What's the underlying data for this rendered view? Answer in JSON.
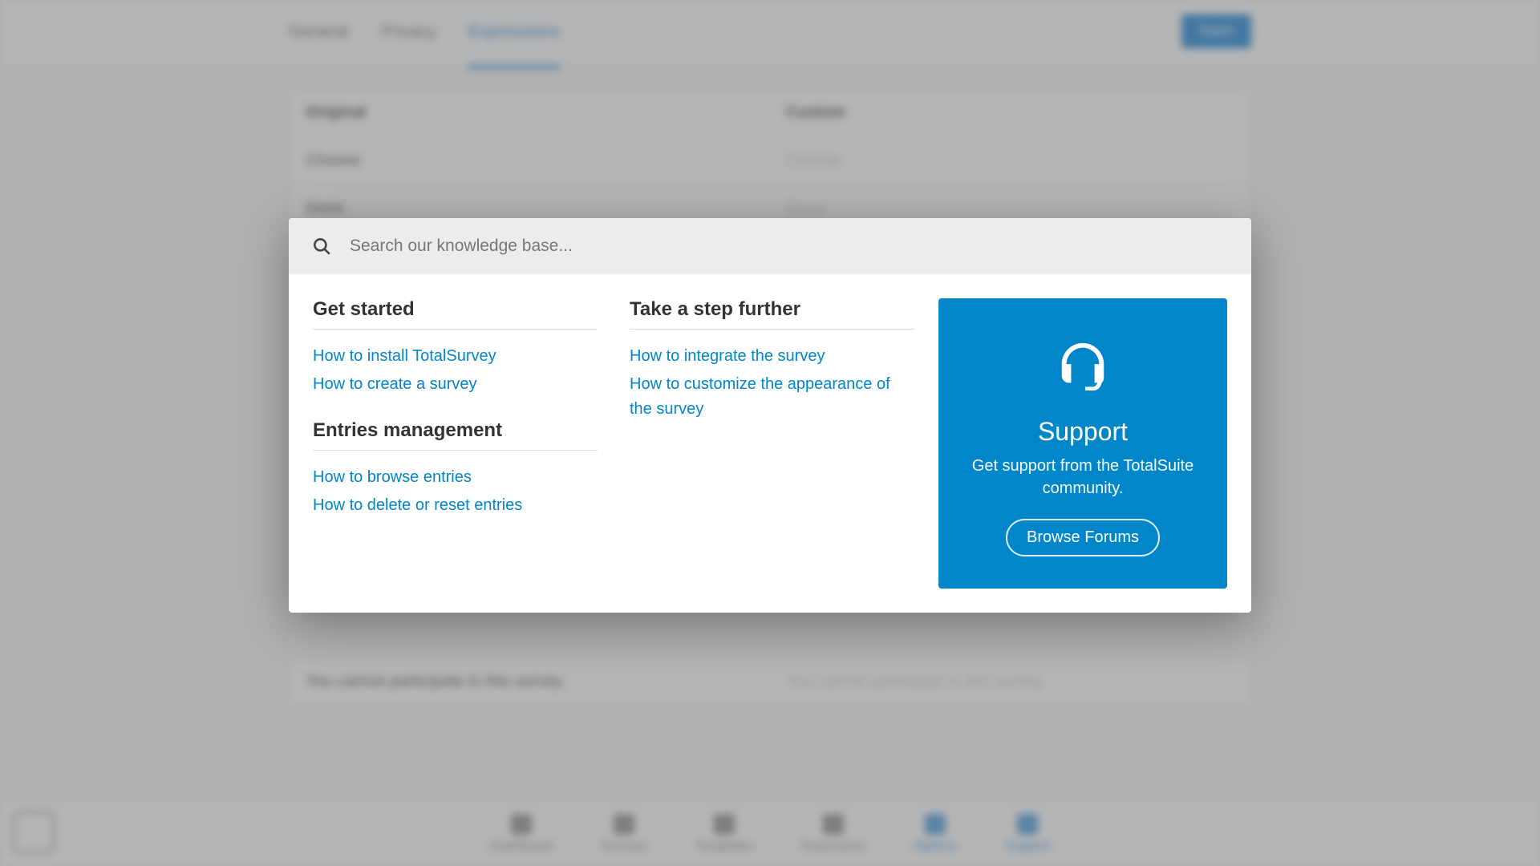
{
  "bg": {
    "tabs": [
      "General",
      "Privacy",
      "Expressions"
    ],
    "active_tab_index": 2,
    "save_label": "Save",
    "columns": {
      "original": "Original",
      "custom": "Custom"
    },
    "rows": [
      {
        "original": "Choose",
        "custom_placeholder": "Choose"
      },
      {
        "original": "Done",
        "custom_placeholder": "Done"
      }
    ],
    "bottom_row": {
      "original": "You cannot participate in this survey.",
      "custom_placeholder": "You cannot participate in this survey."
    },
    "nav": [
      "Dashboard",
      "Surveys",
      "Templates",
      "Extensions",
      "Options",
      "Support"
    ],
    "active_nav": [
      "Options",
      "Support"
    ]
  },
  "search": {
    "placeholder": "Search our knowledge base..."
  },
  "sections": {
    "get_started": {
      "title": "Get started",
      "links": [
        "How to install TotalSurvey",
        "How to create a survey"
      ]
    },
    "entries": {
      "title": "Entries management",
      "links": [
        "How to browse entries",
        "How to delete or reset entries"
      ]
    },
    "further": {
      "title": "Take a step further",
      "links": [
        "How to integrate the survey",
        "How to customize the appearance of the survey"
      ]
    }
  },
  "support": {
    "title": "Support",
    "desc": "Get support from the TotalSuite community.",
    "button": "Browse Forums"
  }
}
